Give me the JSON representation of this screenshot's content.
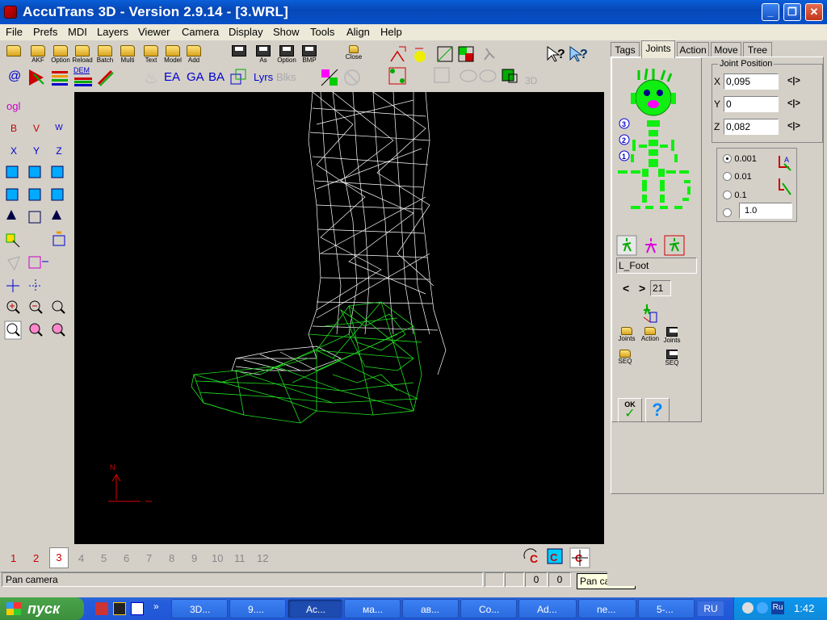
{
  "window": {
    "title": "AccuTrans 3D - Version 2.9.14 - [3.WRL]"
  },
  "menu": [
    "File",
    "Prefs",
    "MDI",
    "Layers",
    "Viewer",
    "Camera",
    "Display",
    "Show",
    "Tools",
    "Align",
    "Help"
  ],
  "toolbar": {
    "row1": [
      "AKF",
      "Option",
      "Reload",
      "Batch",
      "Multi",
      "Text",
      "Model",
      "Add",
      "As",
      "Option",
      "BMP",
      "Close"
    ],
    "row2_text": [
      "DEM",
      "EA",
      "GA",
      "BA"
    ]
  },
  "leftbar": {
    "ogl": "ogl",
    "b": "B",
    "v": "V",
    "w": "W",
    "x": "X",
    "y": "Y",
    "z": "Z"
  },
  "viewport": {
    "axis_label": "N"
  },
  "bottom": {
    "pages": [
      "1",
      "2",
      "3",
      "4",
      "5",
      "6",
      "7",
      "8",
      "9",
      "10",
      "11",
      "12"
    ],
    "active_page": "3"
  },
  "status": {
    "text": "Pan camera",
    "f1": "0",
    "f2": "0"
  },
  "tooltip": "Pan camera",
  "panel": {
    "tabs": [
      "Tags",
      "Joints",
      "Action",
      "Move",
      "Tree"
    ],
    "active_tab": "Joints",
    "joint_position_title": "Joint Position",
    "x_label": "X",
    "x_value": "0,095",
    "y_label": "Y",
    "y_value": "0",
    "z_label": "Z",
    "z_value": "0,082",
    "steps": [
      "0.001",
      "0.01",
      "0.1"
    ],
    "custom_step": "1.0",
    "level_nums": [
      "3",
      "2",
      "1"
    ],
    "joint_name": "L_Foot",
    "joint_index": "21",
    "prev": "<",
    "next": ">",
    "arrows": "<|>",
    "file_buttons": [
      "Joints",
      "Action",
      "Joints"
    ],
    "seq_buttons": [
      "SEQ",
      "SEQ"
    ],
    "ok": "OK",
    "help": "?"
  },
  "taskbar": {
    "start": "пуск",
    "buttons": [
      "3D...",
      "9....",
      "Ac...",
      "ма...",
      "ав...",
      "Co...",
      "Ad...",
      "ne...",
      "5-..."
    ],
    "lang": "RU",
    "tray_lang": "Ru",
    "clock": "1:42"
  },
  "colors": {
    "wire_white": "#ffffff",
    "wire_green": "#22e022",
    "accent_red": "#cc0000"
  }
}
